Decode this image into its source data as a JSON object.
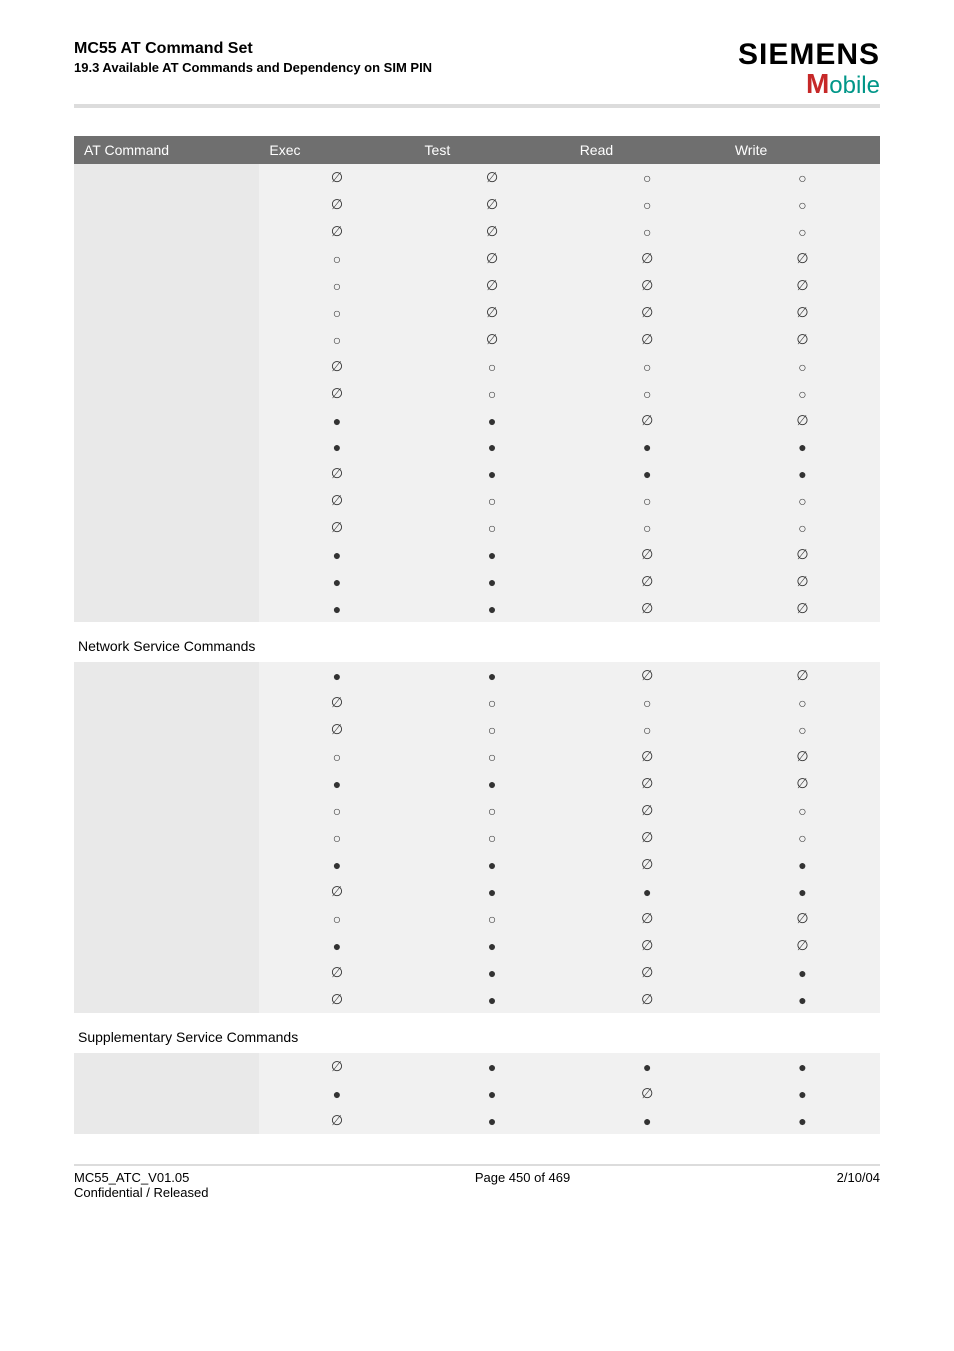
{
  "header": {
    "doc_title": "MC55 AT Command Set",
    "doc_subtitle": "19.3 Available AT Commands and Dependency on SIM PIN",
    "brand_top": "SIEMENS",
    "brand_m": "M",
    "brand_rest": "obile"
  },
  "legend": {
    "na": "∅",
    "nopin": "○",
    "pin": "●"
  },
  "columns": [
    "AT Command",
    "Exec",
    "Test",
    "Read",
    "Write"
  ],
  "rows": [
    {
      "type": "data",
      "cmd": "",
      "v": [
        "na",
        "na",
        "nopin",
        "nopin"
      ]
    },
    {
      "type": "data",
      "cmd": "",
      "v": [
        "na",
        "na",
        "nopin",
        "nopin"
      ]
    },
    {
      "type": "data",
      "cmd": "",
      "v": [
        "na",
        "na",
        "nopin",
        "nopin"
      ]
    },
    {
      "type": "data",
      "cmd": "",
      "v": [
        "nopin",
        "na",
        "na",
        "na"
      ]
    },
    {
      "type": "data",
      "cmd": "",
      "v": [
        "nopin",
        "na",
        "na",
        "na"
      ]
    },
    {
      "type": "data",
      "cmd": "",
      "v": [
        "nopin",
        "na",
        "na",
        "na"
      ]
    },
    {
      "type": "data",
      "cmd": "",
      "v": [
        "nopin",
        "na",
        "na",
        "na"
      ]
    },
    {
      "type": "data",
      "cmd": "",
      "v": [
        "na",
        "nopin",
        "nopin",
        "nopin"
      ]
    },
    {
      "type": "data",
      "cmd": "",
      "v": [
        "na",
        "nopin",
        "nopin",
        "nopin"
      ]
    },
    {
      "type": "data",
      "cmd": "",
      "v": [
        "pin",
        "pin",
        "na",
        "na"
      ]
    },
    {
      "type": "data",
      "cmd": "",
      "v": [
        "pin",
        "pin",
        "pin",
        "pin"
      ]
    },
    {
      "type": "data",
      "cmd": "",
      "v": [
        "na",
        "pin",
        "pin",
        "pin"
      ]
    },
    {
      "type": "data",
      "cmd": "",
      "v": [
        "na",
        "nopin",
        "nopin",
        "nopin"
      ]
    },
    {
      "type": "data",
      "cmd": "",
      "v": [
        "na",
        "nopin",
        "nopin",
        "nopin"
      ]
    },
    {
      "type": "data",
      "cmd": "",
      "v": [
        "pin",
        "pin",
        "na",
        "na"
      ]
    },
    {
      "type": "data",
      "cmd": "",
      "v": [
        "pin",
        "pin",
        "na",
        "na"
      ]
    },
    {
      "type": "data",
      "cmd": "",
      "v": [
        "pin",
        "pin",
        "na",
        "na"
      ]
    },
    {
      "type": "section",
      "label": "Network Service Commands"
    },
    {
      "type": "data",
      "cmd": "",
      "v": [
        "pin",
        "pin",
        "na",
        "na"
      ]
    },
    {
      "type": "data",
      "cmd": "",
      "v": [
        "na",
        "nopin",
        "nopin",
        "nopin"
      ]
    },
    {
      "type": "data",
      "cmd": "",
      "v": [
        "na",
        "nopin",
        "nopin",
        "nopin"
      ]
    },
    {
      "type": "data",
      "cmd": "",
      "v": [
        "nopin",
        "nopin",
        "na",
        "na"
      ]
    },
    {
      "type": "data",
      "cmd": "",
      "v": [
        "pin",
        "pin",
        "na",
        "na"
      ]
    },
    {
      "type": "data",
      "cmd": "",
      "v": [
        "nopin",
        "nopin",
        "na",
        "nopin"
      ]
    },
    {
      "type": "data",
      "cmd": "",
      "v": [
        "nopin",
        "nopin",
        "na",
        "nopin"
      ]
    },
    {
      "type": "data",
      "cmd": "",
      "v": [
        "pin",
        "pin",
        "na",
        "pin"
      ]
    },
    {
      "type": "data",
      "cmd": "",
      "v": [
        "na",
        "pin",
        "pin",
        "pin"
      ]
    },
    {
      "type": "data",
      "cmd": "",
      "v": [
        "nopin",
        "nopin",
        "na",
        "na"
      ]
    },
    {
      "type": "data",
      "cmd": "",
      "v": [
        "pin",
        "pin",
        "na",
        "na"
      ]
    },
    {
      "type": "data",
      "cmd": "",
      "v": [
        "na",
        "pin",
        "na",
        "pin"
      ]
    },
    {
      "type": "data",
      "cmd": "",
      "v": [
        "na",
        "pin",
        "na",
        "pin"
      ]
    },
    {
      "type": "section",
      "label": "Supplementary Service Commands"
    },
    {
      "type": "data",
      "cmd": "",
      "v": [
        "na",
        "pin",
        "pin",
        "pin"
      ]
    },
    {
      "type": "data",
      "cmd": "",
      "v": [
        "pin",
        "pin",
        "na",
        "pin"
      ]
    },
    {
      "type": "data",
      "cmd": "",
      "v": [
        "na",
        "pin",
        "pin",
        "pin"
      ]
    }
  ],
  "footer": {
    "left_line1": "MC55_ATC_V01.05",
    "left_line2": "Confidential / Released",
    "center": "Page 450 of 469",
    "right": "2/10/04"
  }
}
